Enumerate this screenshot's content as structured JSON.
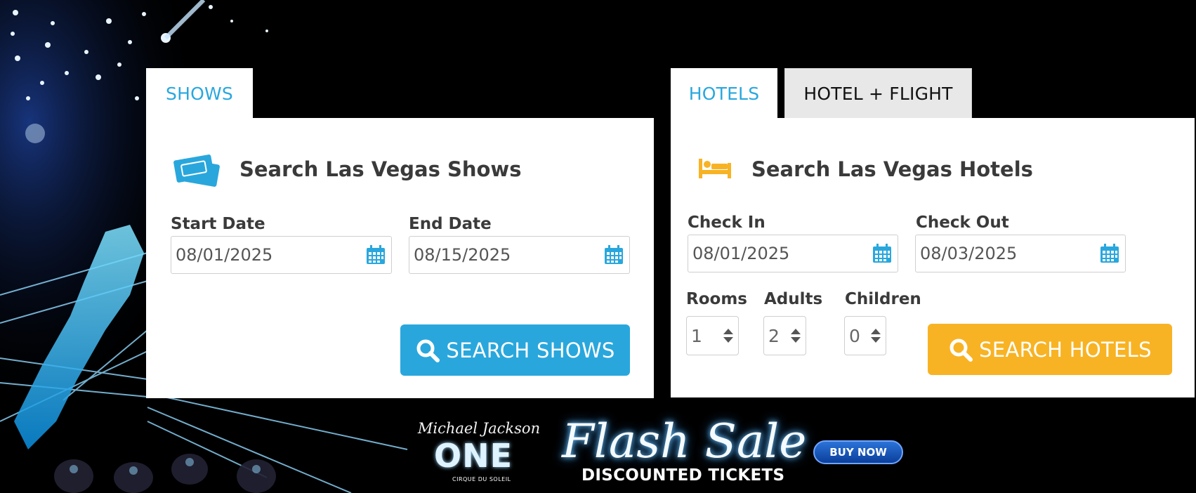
{
  "shows": {
    "tab_label": "SHOWS",
    "title": "Search Las Vegas Shows",
    "start_label": "Start Date",
    "start_value": "08/01/2025",
    "end_label": "End Date",
    "end_value": "08/15/2025",
    "search_label": "SEARCH SHOWS",
    "icon": "tickets-icon"
  },
  "hotels": {
    "tab_label": "HOTELS",
    "tab2_label": "HOTEL + FLIGHT",
    "title": "Search Las Vegas Hotels",
    "checkin_label": "Check In",
    "checkin_value": "08/01/2025",
    "checkout_label": "Check Out",
    "checkout_value": "08/03/2025",
    "rooms_label": "Rooms",
    "rooms_value": "1",
    "adults_label": "Adults",
    "adults_value": "2",
    "children_label": "Children",
    "children_value": "0",
    "search_label": "SEARCH HOTELS",
    "icon": "bed-icon"
  },
  "banner": {
    "mj_script": "Michael Jackson",
    "mj_one": "ONE",
    "mj_cirque": "CIRQUE DU SOLEIL",
    "flash": "Flash Sale",
    "discount": "DISCOUNTED TICKETS",
    "buy_now": "BUY NOW"
  },
  "colors": {
    "accent_blue": "#29a7dd",
    "accent_yellow": "#f8b324",
    "background": "#000000"
  }
}
